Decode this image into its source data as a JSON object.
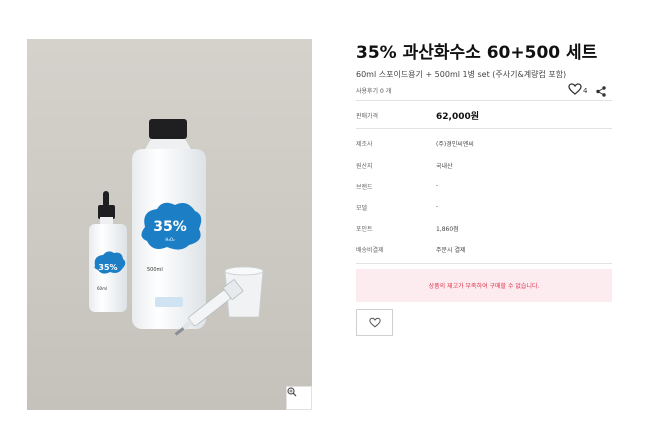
{
  "product": {
    "title": "35% 과산화수소 60+500 세트",
    "subtitle": "60ml 스포이드용기 + 500ml 1병 set (주사기&계량컵 포함)",
    "reviews": "사용후기 0 개",
    "wish_count": "4",
    "label_1ml": "60ml",
    "label_500ml": "500ml",
    "badge_text": "35%"
  },
  "price": {
    "label": "판매가격",
    "value": "62,000원"
  },
  "details": [
    {
      "label": "제조사",
      "value": "(주)경인씨엔씨"
    },
    {
      "label": "원산지",
      "value": "국내산"
    },
    {
      "label": "브랜드",
      "value": "-"
    },
    {
      "label": "모델",
      "value": "-"
    },
    {
      "label": "포인트",
      "value": "1,860점"
    },
    {
      "label": "배송비결제",
      "value": "주문시 결제"
    }
  ],
  "notice": {
    "soldout": "상품의 재고가 부족하여 구매할 수 없습니다."
  },
  "colors": {
    "accent": "#e0364f",
    "notice_bg": "#fcecef",
    "bottle_label": "#1c7fc6"
  }
}
